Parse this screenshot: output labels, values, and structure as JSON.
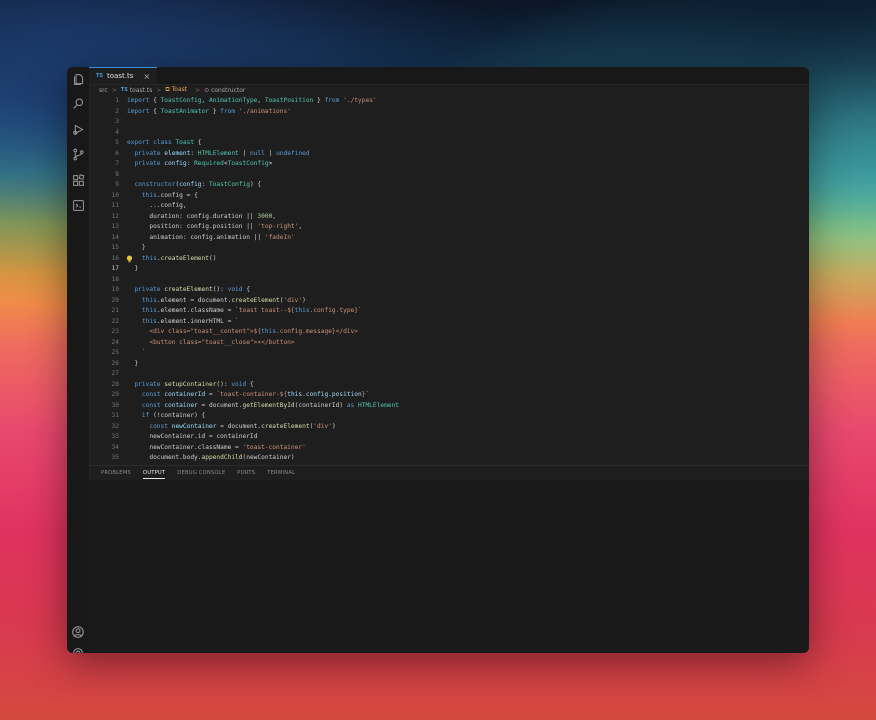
{
  "tab": {
    "badge": "TS",
    "filename": "toast.ts",
    "close": "×"
  },
  "breadcrumb": {
    "folder": "src",
    "sep1": ">",
    "file_badge": "TS",
    "file": "toast.ts",
    "sep2": ">",
    "class": "Toast",
    "sep3": ">",
    "method": "constructor"
  },
  "editor": {
    "active_line": 17,
    "lines": [
      {
        "n": "1",
        "parts": [
          [
            "kw",
            "import "
          ],
          [
            "",
            "{ "
          ],
          [
            "ty",
            "ToastConfig"
          ],
          [
            "",
            ", "
          ],
          [
            "ty",
            "AnimationType"
          ],
          [
            "",
            ", "
          ],
          [
            "ty",
            "ToastPosition"
          ],
          [
            "",
            " } "
          ],
          [
            "kw",
            "from "
          ],
          [
            "str",
            "'./types'"
          ]
        ]
      },
      {
        "n": "2",
        "parts": [
          [
            "kw",
            "import "
          ],
          [
            "",
            "{ "
          ],
          [
            "ty",
            "ToastAnimator"
          ],
          [
            "",
            " } "
          ],
          [
            "kw",
            "from "
          ],
          [
            "str",
            "'./animations'"
          ]
        ]
      },
      {
        "n": "3",
        "parts": []
      },
      {
        "n": "4",
        "parts": []
      },
      {
        "n": "5",
        "parts": [
          [
            "kw",
            "export class "
          ],
          [
            "ty",
            "Toast "
          ],
          [
            "",
            "{"
          ]
        ]
      },
      {
        "n": "6",
        "parts": [
          [
            "",
            "  "
          ],
          [
            "kw",
            "private "
          ],
          [
            "prop",
            "element"
          ],
          [
            "",
            ": "
          ],
          [
            "ty",
            "HTMLElement"
          ],
          [
            "",
            " | "
          ],
          [
            "kw",
            "null"
          ],
          [
            "",
            " | "
          ],
          [
            "kw",
            "undefined"
          ]
        ]
      },
      {
        "n": "7",
        "parts": [
          [
            "",
            "  "
          ],
          [
            "kw",
            "private "
          ],
          [
            "prop",
            "config"
          ],
          [
            "",
            ": "
          ],
          [
            "ty",
            "Required"
          ],
          [
            "",
            "<"
          ],
          [
            "ty",
            "ToastConfig"
          ],
          [
            "",
            ">"
          ]
        ]
      },
      {
        "n": "8",
        "parts": []
      },
      {
        "n": "9",
        "parts": [
          [
            "",
            "  "
          ],
          [
            "kw",
            "constructor"
          ],
          [
            "",
            "("
          ],
          [
            "prop",
            "config"
          ],
          [
            "",
            ": "
          ],
          [
            "ty",
            "ToastConfig"
          ],
          [
            "",
            ") {"
          ]
        ]
      },
      {
        "n": "10",
        "parts": [
          [
            "",
            "    "
          ],
          [
            "kw",
            "this"
          ],
          [
            "",
            ".config = {"
          ]
        ]
      },
      {
        "n": "11",
        "parts": [
          [
            "",
            "      ...config,"
          ]
        ]
      },
      {
        "n": "12",
        "parts": [
          [
            "",
            "      duration: config.duration || "
          ],
          [
            "num",
            "3000"
          ],
          [
            "",
            ","
          ]
        ]
      },
      {
        "n": "13",
        "parts": [
          [
            "",
            "      position: config.position || "
          ],
          [
            "str",
            "'top-right'"
          ],
          [
            "",
            ","
          ]
        ]
      },
      {
        "n": "14",
        "parts": [
          [
            "",
            "      animation: config.animation || "
          ],
          [
            "str",
            "'fadeIn'"
          ]
        ]
      },
      {
        "n": "15",
        "parts": [
          [
            "",
            "    }"
          ]
        ]
      },
      {
        "n": "16",
        "parts": [
          [
            "",
            "    "
          ],
          [
            "kw",
            "this"
          ],
          [
            "",
            "."
          ],
          [
            "fn",
            "createElement"
          ],
          [
            "",
            "()"
          ]
        ]
      },
      {
        "n": "17",
        "parts": [
          [
            "",
            "  }"
          ]
        ]
      },
      {
        "n": "18",
        "parts": []
      },
      {
        "n": "19",
        "parts": [
          [
            "",
            "  "
          ],
          [
            "kw",
            "private "
          ],
          [
            "fn",
            "createElement"
          ],
          [
            "",
            "(): "
          ],
          [
            "kw",
            "void"
          ],
          [
            "",
            " {"
          ]
        ]
      },
      {
        "n": "20",
        "parts": [
          [
            "",
            "    "
          ],
          [
            "kw",
            "this"
          ],
          [
            "",
            ".element = document."
          ],
          [
            "fn",
            "createElement"
          ],
          [
            "",
            "("
          ],
          [
            "str",
            "'div'"
          ],
          [
            "",
            ")"
          ]
        ]
      },
      {
        "n": "21",
        "parts": [
          [
            "",
            "    "
          ],
          [
            "kw",
            "this"
          ],
          [
            "",
            ".element.className = "
          ],
          [
            "str",
            "`toast toast--${"
          ],
          [
            "kw",
            "this"
          ],
          [
            "str",
            ".config.type}`"
          ]
        ]
      },
      {
        "n": "22",
        "parts": [
          [
            "",
            "    "
          ],
          [
            "kw",
            "this"
          ],
          [
            "",
            ".element.innerHTML = "
          ],
          [
            "str",
            "`"
          ]
        ]
      },
      {
        "n": "23",
        "parts": [
          [
            "str",
            "      <div class=\"toast__content\">${"
          ],
          [
            "kw",
            "this"
          ],
          [
            "str",
            ".config.message}</div>"
          ]
        ]
      },
      {
        "n": "24",
        "parts": [
          [
            "str",
            "      <button class=\"toast__close\">×</button>"
          ]
        ]
      },
      {
        "n": "25",
        "parts": [
          [
            "str",
            "    `"
          ]
        ]
      },
      {
        "n": "26",
        "parts": [
          [
            "",
            "  }"
          ]
        ]
      },
      {
        "n": "27",
        "parts": []
      },
      {
        "n": "28",
        "parts": [
          [
            "",
            "  "
          ],
          [
            "kw",
            "private "
          ],
          [
            "fn",
            "setupContainer"
          ],
          [
            "",
            "(): "
          ],
          [
            "kw",
            "void"
          ],
          [
            "",
            " {"
          ]
        ]
      },
      {
        "n": "29",
        "parts": [
          [
            "",
            "    "
          ],
          [
            "kw",
            "const "
          ],
          [
            "prop",
            "containerId"
          ],
          [
            "",
            " = "
          ],
          [
            "str",
            "`toast-container-${"
          ],
          [
            "prop",
            "this.config.position"
          ],
          [
            "str",
            "}`"
          ]
        ]
      },
      {
        "n": "30",
        "parts": [
          [
            "",
            "    "
          ],
          [
            "kw",
            "const "
          ],
          [
            "prop",
            "container"
          ],
          [
            "",
            " = document."
          ],
          [
            "fn",
            "getElementById"
          ],
          [
            "",
            "(containerId) "
          ],
          [
            "kw",
            "as "
          ],
          [
            "ty",
            "HTMLElement"
          ]
        ]
      },
      {
        "n": "31",
        "parts": [
          [
            "",
            "    "
          ],
          [
            "kw",
            "if "
          ],
          [
            "",
            "(!container) {"
          ]
        ]
      },
      {
        "n": "32",
        "parts": [
          [
            "",
            "      "
          ],
          [
            "kw",
            "const "
          ],
          [
            "prop",
            "newContainer"
          ],
          [
            "",
            " = document."
          ],
          [
            "fn",
            "createElement"
          ],
          [
            "",
            "("
          ],
          [
            "str",
            "'div'"
          ],
          [
            "",
            ")"
          ]
        ]
      },
      {
        "n": "33",
        "parts": [
          [
            "",
            "      newContainer.id = containerId"
          ]
        ]
      },
      {
        "n": "34",
        "parts": [
          [
            "",
            "      newContainer.className = "
          ],
          [
            "str",
            "'toast-container'"
          ]
        ]
      },
      {
        "n": "35",
        "parts": [
          [
            "",
            "      document.body."
          ],
          [
            "fn",
            "appendChild"
          ],
          [
            "",
            "(newContainer)"
          ]
        ]
      }
    ]
  },
  "panel": {
    "tabs": [
      "PROBLEMS",
      "OUTPUT",
      "DEBUG CONSOLE",
      "PORTS",
      "TERMINAL"
    ],
    "active": "OUTPUT"
  },
  "colors": {
    "accent": "#3b8fd8",
    "keyword": "#569cd6",
    "type": "#4ec9b0",
    "string": "#ce9178",
    "function": "#dcdcaa"
  },
  "icons": {
    "activity": [
      "explorer-icon",
      "search-icon",
      "run-debug-icon",
      "source-control-icon",
      "extensions-icon",
      "remote-icon"
    ],
    "bottom": [
      "account-icon",
      "manage-gear-icon"
    ],
    "editor": [
      "lightbulb-icon"
    ]
  }
}
